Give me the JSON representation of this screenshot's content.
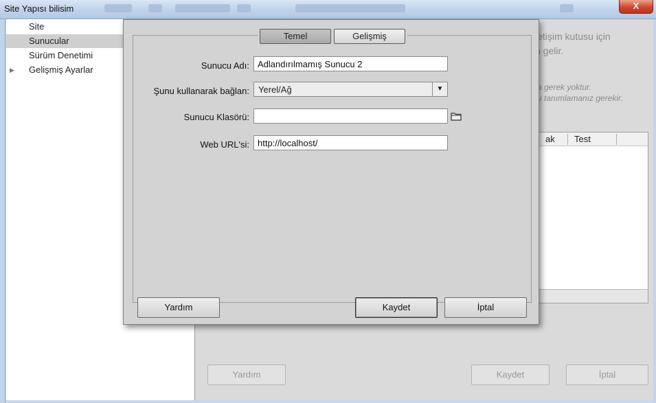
{
  "window": {
    "title": "Site Yapısı bilisim",
    "close_label": "X"
  },
  "sidebar": {
    "items": [
      {
        "label": "Site"
      },
      {
        "label": "Sunucular"
      },
      {
        "label": "Sürüm Denetimi"
      },
      {
        "label": "Gelişmiş Ayarlar"
      }
    ],
    "expand_icon": "triangle-right-icon"
  },
  "background": {
    "line1": "letişim kutusu için",
    "line2": "n gelir.",
    "italic1": "za gerek yoktur.",
    "italic2": "cu tanımlamanız gerekir.",
    "table_headers": [
      "ak",
      "Test"
    ],
    "help_label": "Yardım",
    "save_label": "Kaydet",
    "cancel_label": "İptal"
  },
  "dialog": {
    "tabs": [
      {
        "label": "Temel",
        "active": true
      },
      {
        "label": "Gelişmiş",
        "active": false
      }
    ],
    "fields": {
      "server_name": {
        "label": "Sunucu Adı:",
        "value": "Adlandırılmamış Sunucu 2"
      },
      "connect_using": {
        "label": "Şunu kullanarak bağlan:",
        "value": "Yerel/Ağ"
      },
      "server_folder": {
        "label": "Sunucu Klasörü:",
        "value": ""
      },
      "web_url": {
        "label": "Web URL'si:",
        "value": "http://localhost/"
      }
    },
    "folder_icon": "folder-icon",
    "help_label": "Yardım",
    "save_label": "Kaydet",
    "cancel_label": "İptal"
  },
  "colors": {
    "dialog_bg": "#d3d3d3",
    "selected_item_bg": "#cfcfcf",
    "close_button": "#d0452b"
  }
}
